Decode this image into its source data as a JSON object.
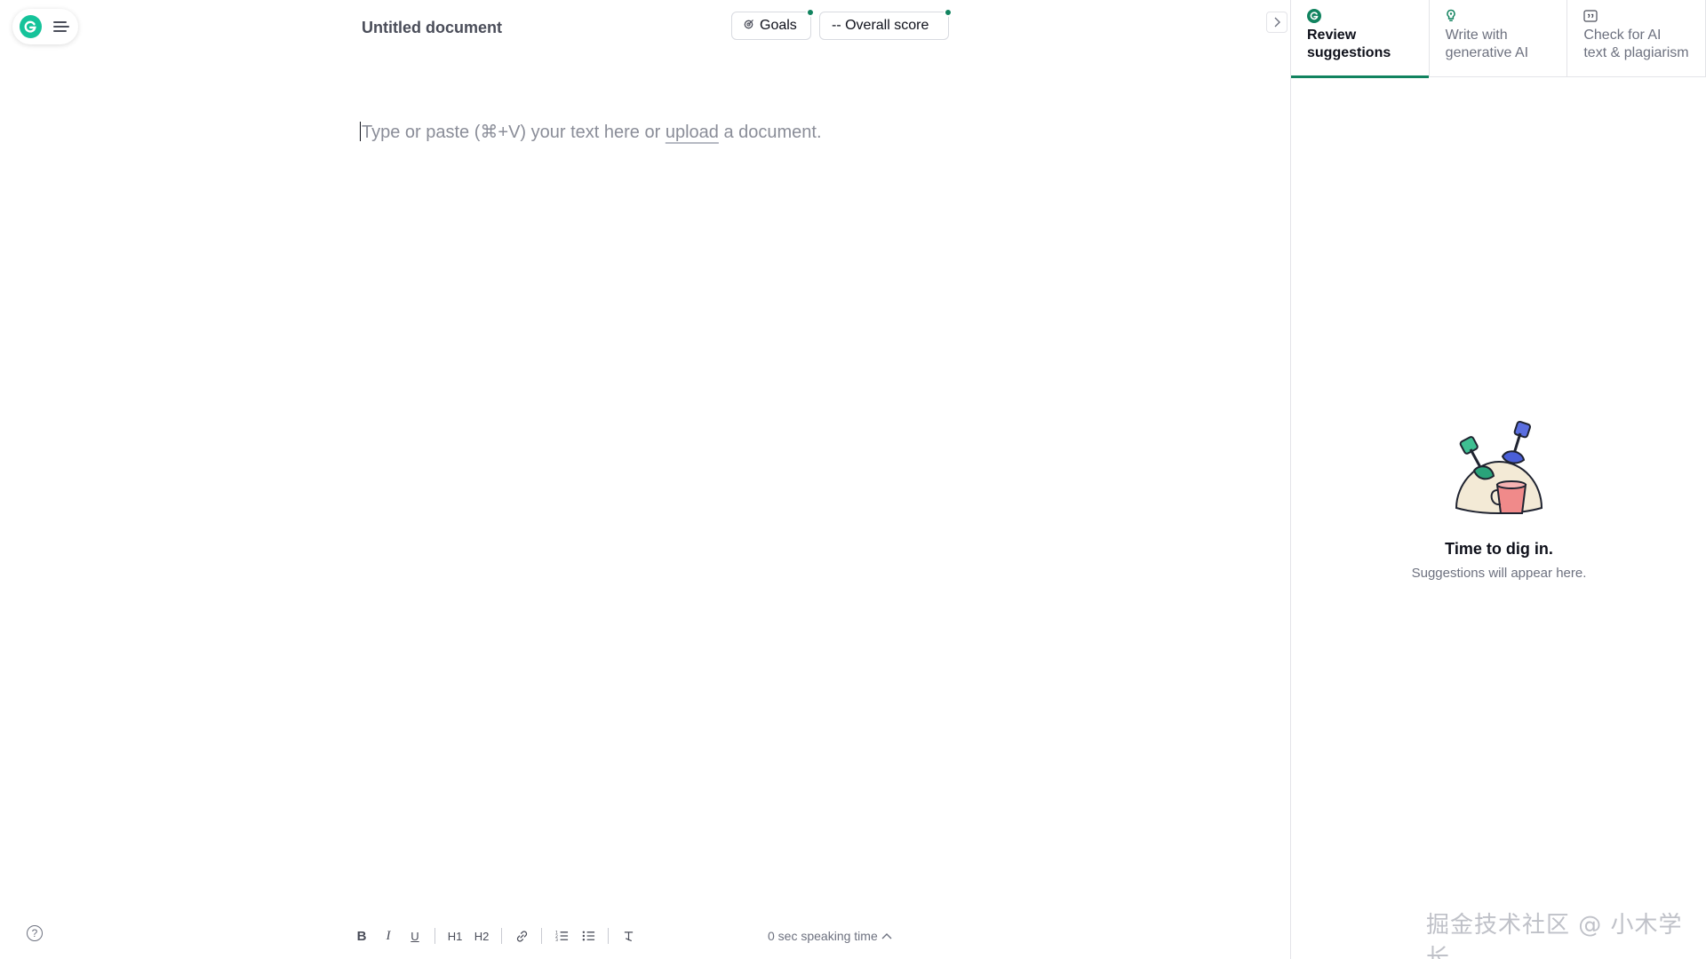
{
  "document": {
    "title": "Untitled document",
    "placeholder_before": "Type or paste (⌘+V) your text here or ",
    "placeholder_link": "upload",
    "placeholder_after": " a document."
  },
  "header": {
    "goals_label": "Goals",
    "score_label": "-- Overall score"
  },
  "sidebar": {
    "tabs": [
      {
        "label_line1": "Review",
        "label_line2": "suggestions",
        "icon": "grammarly-g-icon",
        "active": true
      },
      {
        "label_line1": "Write with",
        "label_line2": "generative AI",
        "icon": "lightbulb-icon",
        "active": false
      },
      {
        "label_line1": "Check for AI",
        "label_line2": "text & plagiarism",
        "icon": "quote-icon",
        "active": false
      }
    ],
    "empty_title": "Time to dig in.",
    "empty_subtitle": "Suggestions will appear here."
  },
  "toolbar": {
    "bold": "B",
    "italic": "I",
    "underline": "U",
    "h1": "H1",
    "h2": "H2",
    "speaking_time": "0 sec speaking time"
  },
  "watermark": "掘金技术社区 @ 小木学长",
  "colors": {
    "accent": "#11835f",
    "brand": "#15c39a"
  }
}
